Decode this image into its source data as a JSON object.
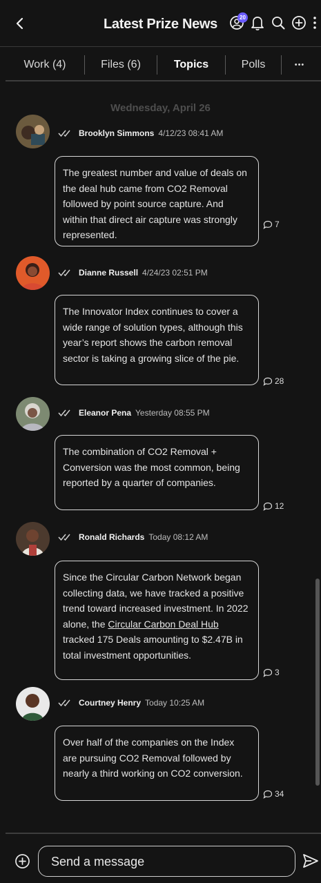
{
  "header": {
    "title": "Latest Prize News",
    "notification_count": "20"
  },
  "tabs": [
    {
      "label": "Work (4)"
    },
    {
      "label": "Files (6)"
    },
    {
      "label": "Topics"
    },
    {
      "label": "Polls"
    },
    {
      "label": "•••"
    }
  ],
  "feed": {
    "date_divider": "Wednesday, April 26",
    "messages": [
      {
        "author": "Brooklyn Simmons",
        "timestamp": "4/12/23 08:41 AM",
        "text": "The greatest number and value of deals on the deal hub came from CO2 Removal followed by point source capture. And within that direct air capture was strongly represented.",
        "reply_count": "7"
      },
      {
        "author": "Dianne Russell",
        "timestamp": "4/24/23 02:51 PM",
        "text": "The Innovator Index continues to cover a wide range of solution types, although this year’s report shows the carbon removal sector is taking a growing slice of the pie.",
        "reply_count": "28"
      },
      {
        "author": "Eleanor Pena",
        "timestamp": "Yesterday 08:55 PM",
        "text": "The combination of CO2 Removal + Conversion was the most common, being reported by a quarter of companies.",
        "reply_count": "12"
      },
      {
        "author": "Ronald Richards",
        "timestamp": "Today 08:12 AM",
        "text_before_link": "Since the Circular Carbon Network began collecting data, we have tracked a positive trend toward increased investment. In 2022 alone, the ",
        "link_text": "Circular Carbon Deal Hub",
        "text_after_link": " tracked 175 Deals amounting to $2.47B in total investment opportunities.",
        "reply_count": "3"
      },
      {
        "author": "Courtney Henry",
        "timestamp": "Today 10:25 AM",
        "text": "Over half of the companies on the Index are pursuing CO2 Removal followed by nearly a third working on CO2 conversion.",
        "reply_count": "34"
      }
    ]
  },
  "composer": {
    "placeholder": "Send a message"
  },
  "icons": {
    "back": "chevron-left-icon",
    "profile": "user-circle-icon",
    "bell": "bell-icon",
    "search": "search-icon",
    "add": "plus-circle-icon",
    "more": "more-vertical-icon",
    "read_receipt": "double-check-icon",
    "comment": "comment-bubble-icon",
    "send": "send-icon"
  }
}
